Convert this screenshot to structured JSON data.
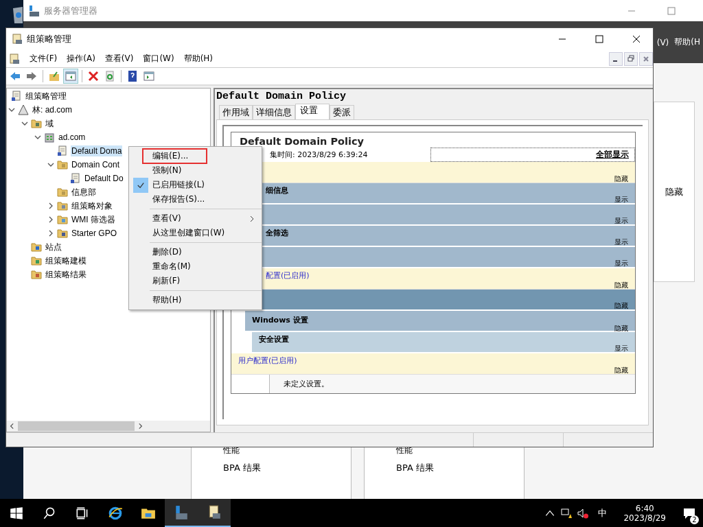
{
  "background_window": {
    "title": "服务器管理器",
    "menu": [
      "(V)",
      "帮助(H"
    ],
    "side_label": "隐藏",
    "tiles": [
      {
        "label_1": "性能",
        "label_2": "BPA 结果"
      },
      {
        "label_1": "性能",
        "label_2": "BPA 结果"
      }
    ]
  },
  "window": {
    "title": "组策略管理",
    "menu": [
      "文件(F)",
      "操作(A)",
      "查看(V)",
      "窗口(W)",
      "帮助(H)"
    ],
    "tree": [
      {
        "label": "组策略管理",
        "kind": "root",
        "children": [
          {
            "label": "林: ad.com",
            "kind": "forest",
            "expanded": true,
            "children": [
              {
                "label": "域",
                "kind": "domains",
                "expanded": true,
                "children": [
                  {
                    "label": "ad.com",
                    "kind": "domain",
                    "expanded": true,
                    "children": [
                      {
                        "label": "Default Doma",
                        "kind": "gpo",
                        "selected": true
                      },
                      {
                        "label": "Domain Cont",
                        "kind": "ou",
                        "expanded": true,
                        "selected": false,
                        "children": [
                          {
                            "label": "Default Do",
                            "kind": "gpo",
                            "selected": false
                          }
                        ]
                      },
                      {
                        "label": "信息部",
                        "kind": "ou",
                        "selected": false
                      },
                      {
                        "label": "组策略对象",
                        "kind": "objects",
                        "expanded": false,
                        "selected": false
                      },
                      {
                        "label": "WMI 筛选器",
                        "kind": "wmi",
                        "expanded": false,
                        "selected": false
                      },
                      {
                        "label": "Starter GPO",
                        "kind": "starter",
                        "expanded": false,
                        "selected": false
                      }
                    ]
                  }
                ]
              },
              {
                "label": "站点",
                "kind": "sites",
                "selected": false
              },
              {
                "label": "组策略建模",
                "kind": "modeling",
                "selected": false
              },
              {
                "label": "组策略结果",
                "kind": "results",
                "selected": false
              }
            ]
          }
        ]
      }
    ],
    "details": {
      "heading": "Default Domain Policy",
      "tabs": [
        {
          "label": "作用域",
          "selected": false
        },
        {
          "label": "详细信息",
          "selected": false
        },
        {
          "label": "设置",
          "selected": true
        },
        {
          "label": "委派",
          "selected": false
        }
      ],
      "report": {
        "title": "Default Domain Policy",
        "collected": "集时间: 2023/8/29 6:39:24",
        "show_all": "全部显示",
        "sections": [
          {
            "kind": "summary",
            "toggle": "隐藏"
          },
          {
            "kind": "category",
            "label": "细信息",
            "toggle": "显示"
          },
          {
            "kind": "category",
            "toggle": "显示"
          },
          {
            "kind": "category",
            "label": "全筛选",
            "toggle": "显示"
          },
          {
            "kind": "category",
            "toggle": "显示"
          },
          {
            "kind": "computer-config",
            "label": "配置(已启用)",
            "toggle": "隐藏"
          },
          {
            "kind": "group",
            "toggle": "隐藏"
          },
          {
            "kind": "windows",
            "label": "Windows 设置",
            "toggle": "隐藏"
          },
          {
            "kind": "security",
            "label": "安全设置",
            "toggle": "显示"
          },
          {
            "kind": "user-config",
            "label": "用户配置(已启用)",
            "toggle": "隐藏"
          },
          {
            "kind": "note",
            "label": "未定义设置。"
          }
        ]
      }
    }
  },
  "context_menu": {
    "items": [
      {
        "kind": "item",
        "label": "编辑(E)...",
        "checked": false,
        "highlighted": true
      },
      {
        "kind": "item",
        "label": "强制(N)",
        "checked": false,
        "highlighted": false
      },
      {
        "kind": "item",
        "label": "已启用链接(L)",
        "checked": true,
        "highlighted": false
      },
      {
        "kind": "item",
        "label": "保存报告(S)...",
        "checked": false,
        "highlighted": false
      },
      {
        "kind": "separator"
      },
      {
        "kind": "submenu",
        "label": "查看(V)",
        "checked": false,
        "highlighted": false
      },
      {
        "kind": "item",
        "label": "从这里创建窗口(W)",
        "checked": false,
        "highlighted": false
      },
      {
        "kind": "separator"
      },
      {
        "kind": "item",
        "label": "删除(D)",
        "checked": false,
        "highlighted": false
      },
      {
        "kind": "item",
        "label": "重命名(M)",
        "checked": false,
        "highlighted": false
      },
      {
        "kind": "item",
        "label": "刷新(F)",
        "checked": false,
        "highlighted": false
      },
      {
        "kind": "separator"
      },
      {
        "kind": "item",
        "label": "帮助(H)",
        "checked": false,
        "highlighted": false
      }
    ]
  },
  "taskbar": {
    "apps": [
      {
        "kind": "start",
        "selected": false
      },
      {
        "kind": "search",
        "selected": false
      },
      {
        "kind": "taskview",
        "selected": false
      },
      {
        "kind": "browser",
        "selected": false
      },
      {
        "kind": "explorer",
        "selected": false
      },
      {
        "kind": "server",
        "selected": true
      },
      {
        "kind": "gpm",
        "selected": true
      }
    ],
    "ime": "中",
    "time": "6:40",
    "date": "2023/8/29",
    "notifications": "2"
  }
}
